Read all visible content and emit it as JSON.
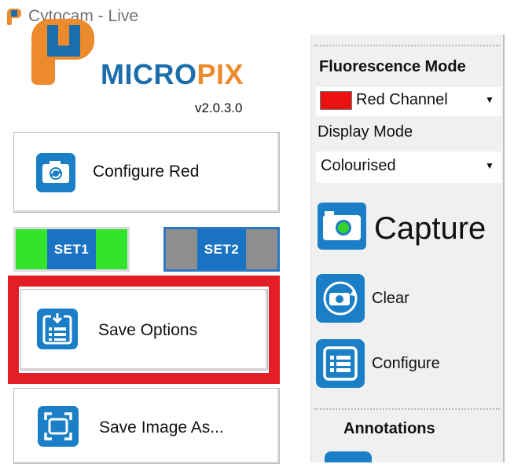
{
  "window": {
    "title": "Cytocam - Live"
  },
  "left_panel": {
    "logo_text_main": "MICRO",
    "logo_text_accent": "PIX",
    "version": "v2.0.3.0",
    "configure_button": {
      "label": "Configure Red",
      "icon": "camera-refresh-icon"
    },
    "set1_label": "SET1",
    "set2_label": "SET2",
    "save_options_button": {
      "label": "Save Options",
      "icon": "save-list-icon"
    },
    "save_image_button": {
      "label": "Save Image As...",
      "icon": "frame-icon"
    }
  },
  "right_panel": {
    "fluorescence_mode_title": "Fluorescence Mode",
    "fluorescence_select": {
      "selected": "Red Channel",
      "swatch_color": "#ee1111"
    },
    "display_mode_label": "Display Mode",
    "display_select": {
      "selected": "Colourised"
    },
    "capture_label": "Capture",
    "clear_label": "Clear",
    "configure_label": "Configure",
    "annotations_title": "Annotations"
  },
  "colors": {
    "accent_blue": "#1a7fc6",
    "logo_orange": "#ec8a2c",
    "highlight_red": "#e31e24",
    "set1_green": "#32e52c",
    "set2_gray": "#8e8e8e"
  }
}
